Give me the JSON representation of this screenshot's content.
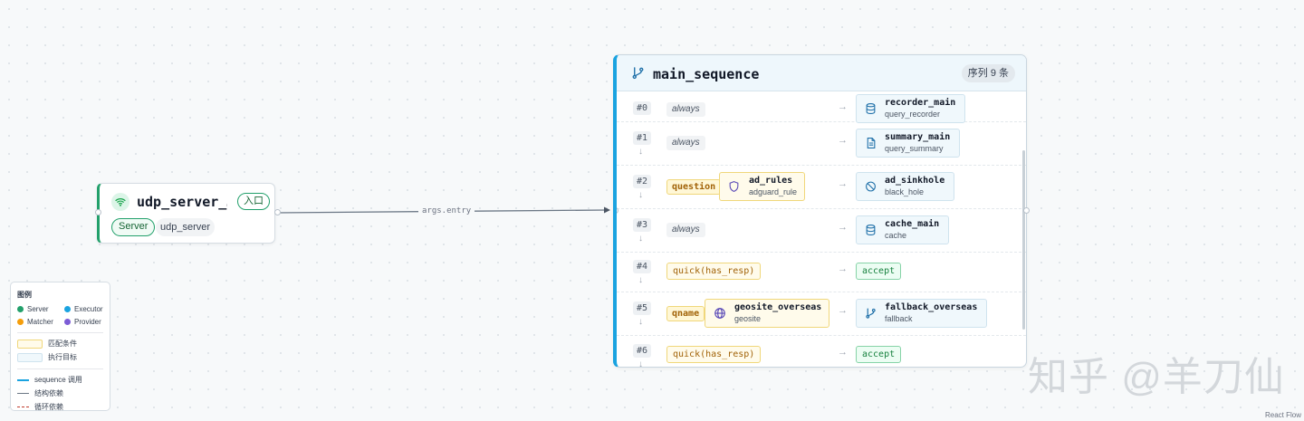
{
  "server_node": {
    "title": "udp_server_…",
    "entry_badge": "入口",
    "kind": "Server",
    "type": "udp_server",
    "icon": "wifi-icon"
  },
  "edge": {
    "label": "args.entry"
  },
  "sequence_node": {
    "title": "main_sequence",
    "count_badge": "序列 9 条",
    "icon": "branch-icon",
    "rows": [
      {
        "index": "#0",
        "condition": "always",
        "arrow": "→",
        "exec_name": "recorder_main",
        "exec_type": "query_recorder",
        "exec_icon": "database-icon"
      },
      {
        "index": "#1",
        "down": "↓",
        "condition": "always",
        "arrow": "→",
        "exec_name": "summary_main",
        "exec_type": "query_summary",
        "exec_icon": "document-icon"
      },
      {
        "index": "#2",
        "down": "↓",
        "condition": "question",
        "matcher_name": "ad_rules",
        "matcher_type": "adguard_rule",
        "matcher_icon": "shield-icon",
        "arrow": "→",
        "exec_name": "ad_sinkhole",
        "exec_type": "black_hole",
        "exec_icon": "block-icon"
      },
      {
        "index": "#3",
        "down": "↓",
        "condition": "always",
        "arrow": "→",
        "exec_name": "cache_main",
        "exec_type": "cache",
        "exec_icon": "database-icon"
      },
      {
        "index": "#4",
        "down": "↓",
        "condition": "quick(has_resp)",
        "arrow": "→",
        "action": "accept"
      },
      {
        "index": "#5",
        "down": "↓",
        "condition": "qname",
        "matcher_name": "geosite_overseas",
        "matcher_type": "geosite",
        "matcher_icon": "globe-icon",
        "arrow": "→",
        "exec_name": "fallback_overseas",
        "exec_type": "fallback",
        "exec_icon": "branch-icon"
      },
      {
        "index": "#6",
        "down": "↓",
        "condition": "quick(has_resp)",
        "arrow": "→",
        "action": "accept"
      }
    ]
  },
  "legend": {
    "title": "图例",
    "kinds": [
      {
        "label": "Server",
        "color": "#22a06b"
      },
      {
        "label": "Executor",
        "color": "#1aa3e0"
      },
      {
        "label": "Matcher",
        "color": "#f59e0b"
      },
      {
        "label": "Provider",
        "color": "#7c5cd6"
      }
    ],
    "match_condition": "匹配条件",
    "exec_target": "执行目标",
    "seq_call": "sequence 调用",
    "struct_dep": "结构依赖",
    "cycle_dep": "循环依赖"
  },
  "watermark": "知乎 @羊刀仙",
  "attribution": "React Flow",
  "colors": {
    "server": "#22a06b",
    "sequence": "#1aa3e0",
    "matcher_bg": "#fffbeb",
    "exec_bg": "#f0f8fc"
  }
}
